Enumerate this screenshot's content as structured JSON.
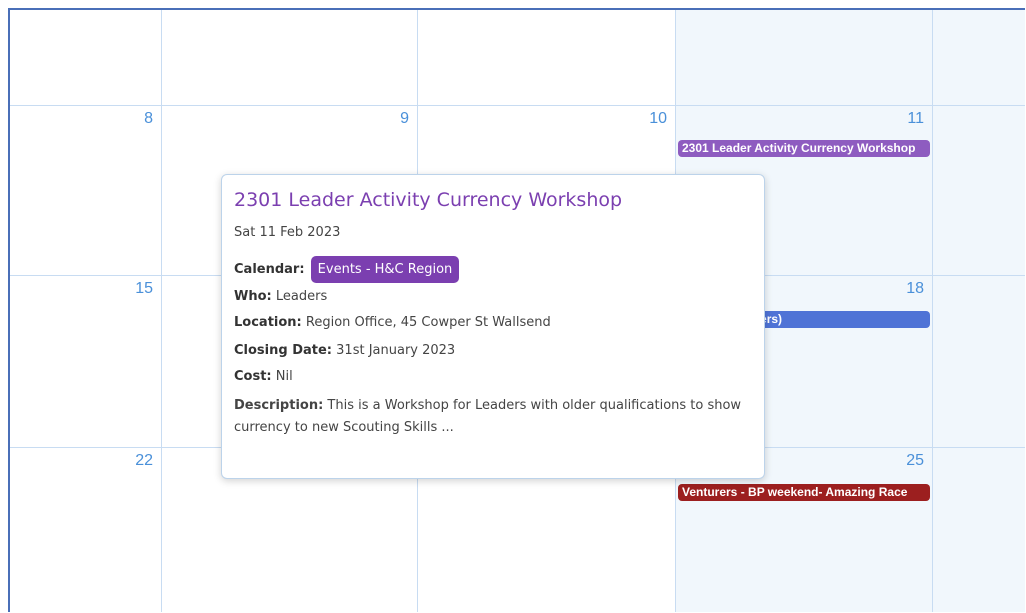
{
  "calendar": {
    "week0": {},
    "week1": {
      "d1": "8",
      "d2": "9",
      "d3": "10",
      "d4": "11"
    },
    "week2": {
      "d1": "15",
      "d4": "18"
    },
    "week3": {
      "d1": "22",
      "d4": "25"
    }
  },
  "events": {
    "e1": {
      "title": "2301 Leader Activity Currency Workshop",
      "color": "#8e5cc0"
    },
    "e2": {
      "title": "Rescue (Leaders)",
      "color": "#4f73d6"
    },
    "e3": {
      "title": "Venturers - BP weekend- Amazing Race",
      "color": "#9c1f1f"
    }
  },
  "popup": {
    "title": "2301 Leader Activity Currency Workshop",
    "date": "Sat 11 Feb 2023",
    "calendar_label": "Calendar:",
    "calendar_value": "Events - H&C Region",
    "who_label": "Who:",
    "who_value": "Leaders",
    "location_label": "Location:",
    "location_value": "Region Office, 45 Cowper St Wallsend",
    "closing_label": "Closing Date:",
    "closing_value": "31st January 2023",
    "cost_label": "Cost:",
    "cost_value": "Nil",
    "description_label": "Description:",
    "description_value": "This is a Workshop for Leaders with older qualifications to show currency to new Scouting Skills ..."
  }
}
